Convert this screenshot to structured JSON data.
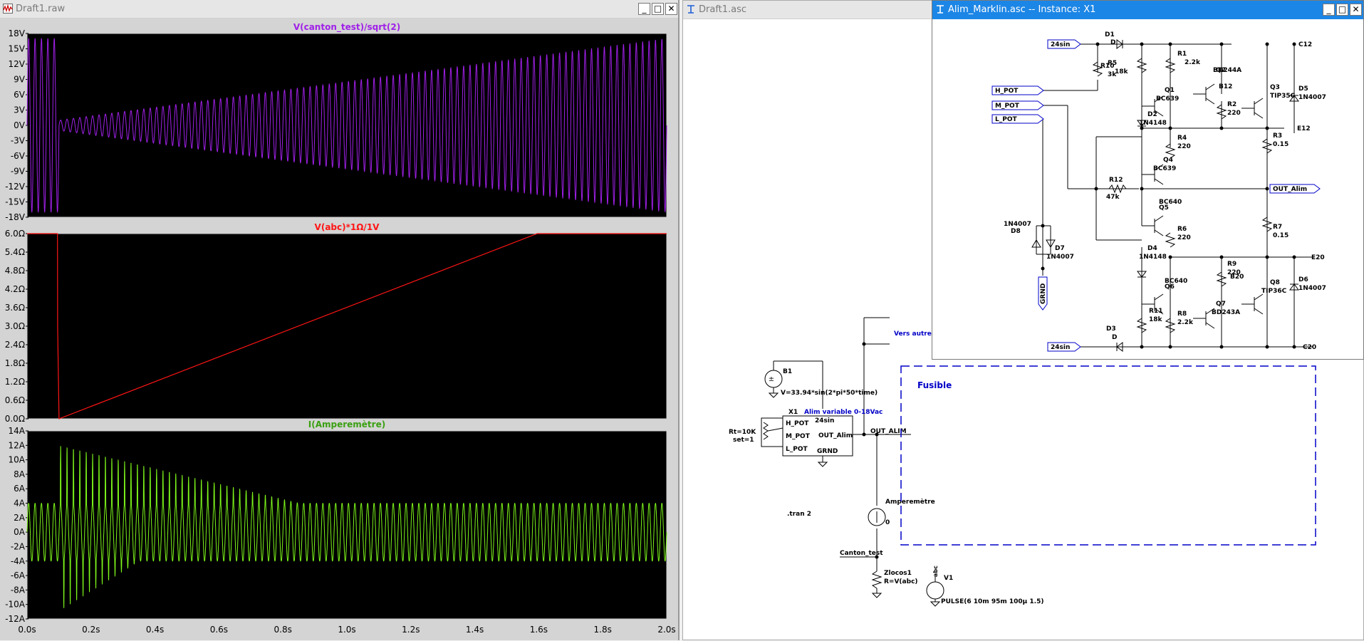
{
  "colors": {
    "plot_bg": "#000000",
    "plot_frame": "#d0d0d0",
    "trace1": "#a020e8",
    "trace2": "#ff1515",
    "trace3": "#7cf51a",
    "wire": "#000000",
    "blue_text": "#0000c8",
    "active_title": "#1c86e6"
  },
  "waveform_window": {
    "title": "Draft1.raw",
    "icon": "waveform-icon",
    "controls": [
      "_",
      "□",
      "✕"
    ]
  },
  "schematic_window": {
    "title": "Draft1.asc",
    "icon": "schematic-icon"
  },
  "subcircuit_window": {
    "title": "Alim_Marklin.asc -- Instance: X1",
    "icon": "schematic-icon",
    "controls": [
      "_",
      "□",
      "✕"
    ]
  },
  "chart_data": [
    {
      "type": "line",
      "title": "V(canton_test)/sqrt(2)",
      "ylim": [
        -18,
        18
      ],
      "yticks": [
        "18V",
        "15V",
        "12V",
        "9V",
        "6V",
        "3V",
        "0V",
        "-3V",
        "-6V",
        "-9V",
        "-12V",
        "-15V",
        "-18V"
      ],
      "xlim": [
        0,
        2
      ],
      "series": [
        {
          "name": "V(canton_test)/sqrt(2)",
          "description": "sinusoid, ±17V before 0.1s, then amplitude growing from ~1V at 0.1s to ~17V at 2.0s"
        }
      ],
      "key_points": {
        "x": [
          0,
          0.1,
          0.1,
          2.0
        ],
        "amplitude": [
          17,
          17,
          1,
          17
        ]
      }
    },
    {
      "type": "line",
      "title": "V(abc)*1Ω/1V",
      "ylim": [
        0,
        6
      ],
      "yticks": [
        "6.0Ω",
        "5.4Ω",
        "4.8Ω",
        "4.2Ω",
        "3.6Ω",
        "3.0Ω",
        "2.4Ω",
        "1.8Ω",
        "1.2Ω",
        "0.6Ω",
        "0.0Ω"
      ],
      "xlim": [
        0,
        2
      ],
      "series": [
        {
          "name": "V(abc)*1Ω/1V",
          "x": [
            0,
            0.095,
            0.0955,
            0.1,
            1.595,
            1.6,
            2.0
          ],
          "y": [
            6,
            6,
            3,
            0,
            6,
            6,
            6
          ]
        }
      ]
    },
    {
      "type": "line",
      "title": "I(Amperemètre)",
      "ylim": [
        -12,
        14
      ],
      "yticks": [
        "14A",
        "12A",
        "10A",
        "8A",
        "6A",
        "4A",
        "2A",
        "0A",
        "-2A",
        "-4A",
        "-6A",
        "-8A",
        "-10A",
        "-12A"
      ],
      "xlim": [
        0,
        2
      ],
      "xticks": [
        "0.0s",
        "0.2s",
        "0.4s",
        "0.6s",
        "0.8s",
        "1.0s",
        "1.2s",
        "1.4s",
        "1.6s",
        "1.8s",
        "2.0s"
      ],
      "series": [
        {
          "name": "I(Amperemètre)",
          "description": "sinusoid ±4A, with spikes up to ~12A / down to ~-11A after 0.1s decaying by ~0.8s"
        }
      ]
    }
  ],
  "schematic": {
    "b1_name": "B1",
    "b1_value": "V=33.94*sin(2*pi*50*time)",
    "x1_name": "X1",
    "x1_desc": "Alim variable 0-18Vac",
    "x1_pins_left": [
      "H_POT",
      "M_POT",
      "L_POT"
    ],
    "x1_pin_top": "24sin",
    "x1_pin_right": "OUT_Alim",
    "x1_pin_bottom": "GRND",
    "pot_params": [
      "Rt=10K",
      "set=1"
    ],
    "net_out": "OUT_ALIM",
    "vers_label": "Vers autres b",
    "fuse_label": "Fusible",
    "ammeter_name": "Amperemètre",
    "ammeter_value": "0",
    "tran": ".tran 2",
    "canton": "Canton_test",
    "zlocos_name": "Zlocos1",
    "zlocos_value": "R=V(abc)",
    "v1_name": "V1",
    "v1_value": "PULSE(6 10m 95m 100µ 1.5)",
    "abc_label": "abc"
  },
  "subcircuit": {
    "ports": [
      "24sin",
      "H_POT",
      "M_POT",
      "L_POT",
      "OUT_Alim",
      "24sin",
      "GRND"
    ],
    "rails": [
      "C12",
      "E12",
      "E20",
      "C20"
    ],
    "parts": [
      [
        "D1",
        "D"
      ],
      [
        "R10",
        "3k"
      ],
      [
        "R5",
        "18k"
      ],
      [
        "R1",
        "2.2k"
      ],
      [
        "Q2",
        "BD244A"
      ],
      [
        "B12",
        ""
      ],
      [
        "Q3",
        "TIP35C"
      ],
      [
        "D5",
        "1N4007"
      ],
      [
        "Q1",
        "BC639"
      ],
      [
        "R2",
        "220"
      ],
      [
        "D2",
        "1N4148"
      ],
      [
        "R4",
        "220"
      ],
      [
        "R3",
        "0.15"
      ],
      [
        "Q4",
        "BC639"
      ],
      [
        "R12",
        "47k"
      ],
      [
        "Q5",
        "BC640"
      ],
      [
        "R6",
        "220"
      ],
      [
        "R7",
        "0.15"
      ],
      [
        "D8",
        "1N4007"
      ],
      [
        "D7",
        "1N4007"
      ],
      [
        "D4",
        "1N4148"
      ],
      [
        "R9",
        "220"
      ],
      [
        "B20",
        ""
      ],
      [
        "Q8",
        "TIP36C"
      ],
      [
        "D6",
        "1N4007"
      ],
      [
        "Q6",
        "BC640"
      ],
      [
        "Q7",
        "BD243A"
      ],
      [
        "R11",
        "18k"
      ],
      [
        "R8",
        "2.2k"
      ],
      [
        "D3",
        "D"
      ]
    ]
  }
}
